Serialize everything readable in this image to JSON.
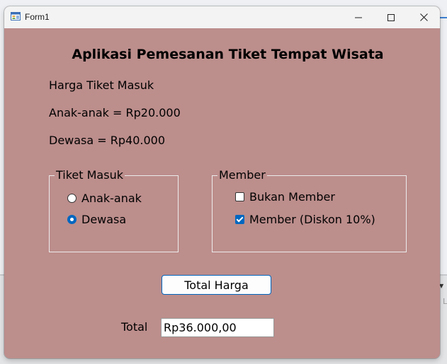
{
  "window": {
    "title": "Form1"
  },
  "form": {
    "heading": "Aplikasi Pemesanan Tiket Tempat Wisata",
    "price_title": "Harga Tiket Masuk",
    "price_child": "Anak-anak = Rp20.000",
    "price_adult": "Dewasa = Rp40.000",
    "ticket_group": {
      "legend": "Tiket Masuk",
      "options": [
        {
          "label": "Anak-anak",
          "selected": false
        },
        {
          "label": "Dewasa",
          "selected": true
        }
      ]
    },
    "member_group": {
      "legend": "Member",
      "options": [
        {
          "label": "Bukan Member",
          "checked": false
        },
        {
          "label": "Member (Diskon 10%)",
          "checked": true
        }
      ]
    },
    "total_button_label": "Total Harga",
    "total_label": "Total",
    "total_value": "Rp36.000,00"
  },
  "colors": {
    "form_background": "#bc8e8c",
    "accent": "#0067c0",
    "titlebar": "#f3f3f3"
  },
  "icons": {
    "app": "form-app-icon",
    "minimize": "minimize-icon",
    "maximize": "maximize-icon",
    "close": "close-icon"
  }
}
